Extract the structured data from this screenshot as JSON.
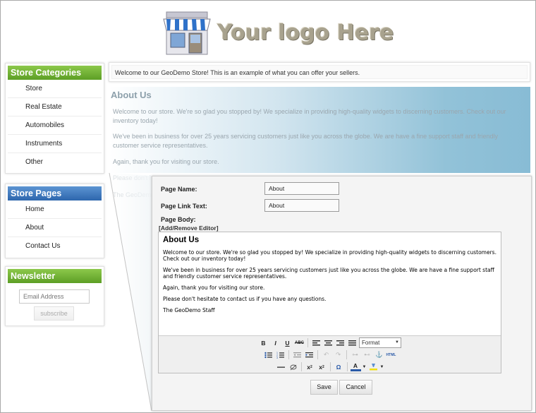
{
  "logo": {
    "text": "Your logo Here",
    "icon": "store-front-icon"
  },
  "categories": {
    "title": "Store Categories",
    "items": [
      "Store",
      "Real Estate",
      "Automobiles",
      "Instruments",
      "Other"
    ]
  },
  "pages": {
    "title": "Store Pages",
    "items": [
      "Home",
      "About",
      "Contact Us"
    ]
  },
  "newsletter": {
    "title": "Newsletter",
    "email_placeholder": "Email Address",
    "subscribe_label": "subscribe"
  },
  "welcome": "Welcome to our GeoDemo Store! This is an example of what you can offer your sellers.",
  "about": {
    "title": "About Us",
    "p1": "Welcome to our store. We're so glad you stopped by! We specialize in providing high-quality widgets to discerning customers. Check out our inventory today!",
    "p2": "We've been in business for over 25 years servicing customers just like you across the globe. We are have a fine support staff and friendly customer service representatives.",
    "p3": "Again, thank you for visiting our store.",
    "p4": "Please don't h",
    "p5": "The GeoDemo"
  },
  "form": {
    "page_name_label": "Page Name:",
    "page_name_value": "About",
    "page_link_label": "Page Link Text:",
    "page_link_value": "About",
    "page_body_label": "Page Body:",
    "add_remove_editor": "[Add/Remove Editor]"
  },
  "editor": {
    "heading": "About Us",
    "p1": "Welcome to our store. We're so glad you stopped by! We specialize in providing high-quality widgets to discerning customers. Check out our inventory today!",
    "p2": "We've been in business for over 25 years servicing customers just like you across the globe. We are have a fine support staff and friendly customer service representatives.",
    "p3": "Again, thank you for visiting our store.",
    "p4": "Please don't hesitate to contact us if you have any questions.",
    "p5": "The GeoDemo Staff",
    "format_select": "Format",
    "html_label": "HTML"
  },
  "buttons": {
    "save": "Save",
    "cancel": "Cancel"
  },
  "colors": {
    "green_header": "#6aaa33",
    "blue_header": "#3a73b6",
    "about_blue": "#88bcd5"
  }
}
